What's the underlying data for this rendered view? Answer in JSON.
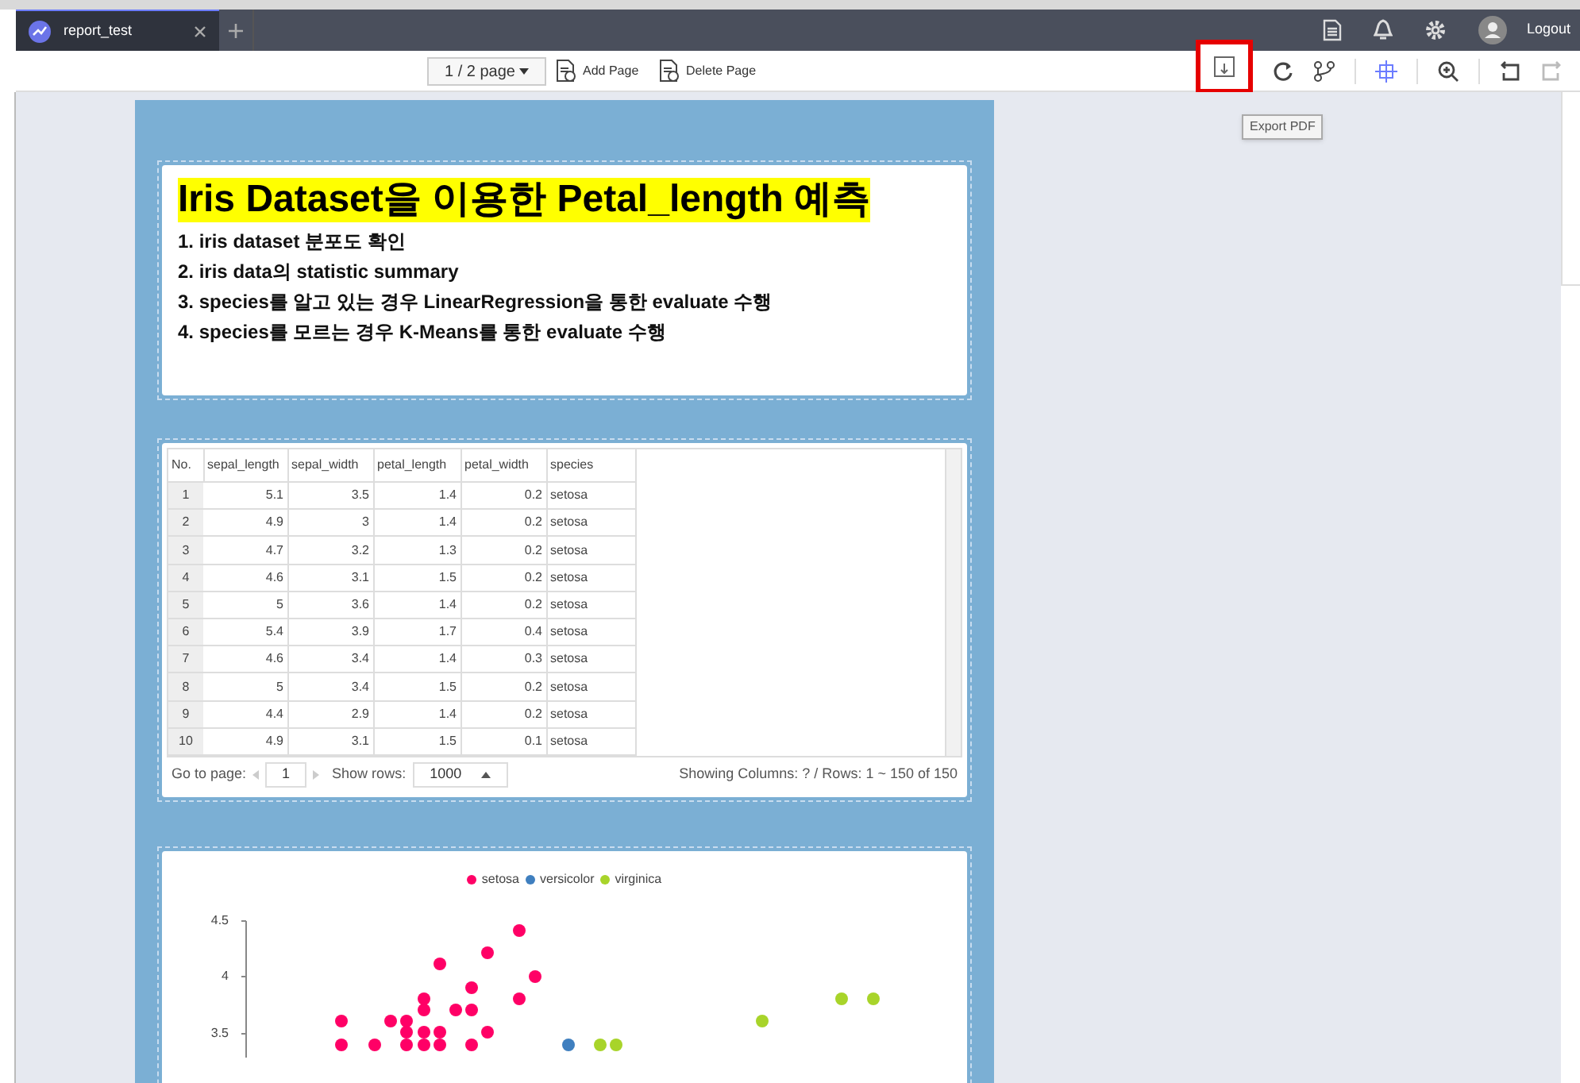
{
  "tabs": [
    {
      "label": "report_test",
      "selected": true
    }
  ],
  "header": {
    "logout": "Logout"
  },
  "toolbar": {
    "page_select": "1 / 2 page",
    "add_page": "Add Page",
    "delete_page": "Delete Page",
    "tooltip": "Export PDF",
    "redo_disabled": true
  },
  "text_card": {
    "title": "Iris Dataset을 이용한 Petal_length 예측",
    "items": [
      "1. iris dataset 분포도 확인",
      "2. iris data의 statistic summary",
      "3. species를 알고 있는 경우 LinearRegression을 통한 evaluate 수행",
      "4. species를 모르는 경우 K-Means를 통한 evaluate 수행"
    ]
  },
  "table": {
    "columns": [
      "No.",
      "sepal_length",
      "sepal_width",
      "petal_length",
      "petal_width",
      "species"
    ],
    "rows": [
      [
        "1",
        "5.1",
        "3.5",
        "1.4",
        "0.2",
        "setosa"
      ],
      [
        "2",
        "4.9",
        "3",
        "1.4",
        "0.2",
        "setosa"
      ],
      [
        "3",
        "4.7",
        "3.2",
        "1.3",
        "0.2",
        "setosa"
      ],
      [
        "4",
        "4.6",
        "3.1",
        "1.5",
        "0.2",
        "setosa"
      ],
      [
        "5",
        "5",
        "3.6",
        "1.4",
        "0.2",
        "setosa"
      ],
      [
        "6",
        "5.4",
        "3.9",
        "1.7",
        "0.4",
        "setosa"
      ],
      [
        "7",
        "4.6",
        "3.4",
        "1.4",
        "0.3",
        "setosa"
      ],
      [
        "8",
        "5",
        "3.4",
        "1.5",
        "0.2",
        "setosa"
      ],
      [
        "9",
        "4.4",
        "2.9",
        "1.4",
        "0.2",
        "setosa"
      ],
      [
        "10",
        "4.9",
        "3.1",
        "1.5",
        "0.1",
        "setosa"
      ]
    ],
    "footer": {
      "goto_label": "Go to page:",
      "page": "1",
      "show_rows_label": "Show rows:",
      "show_rows": "1000",
      "summary": "Showing Columns: ? / Rows: 1 ~ 150 of 150"
    }
  },
  "scatter": {
    "legend": [
      {
        "name": "setosa",
        "color": "#ff0066"
      },
      {
        "name": "versicolor",
        "color": "#3f7fbf"
      },
      {
        "name": "virginica",
        "color": "#a8d42a"
      }
    ],
    "y_ticks": [
      "4.5",
      "4",
      "3.5"
    ]
  }
}
